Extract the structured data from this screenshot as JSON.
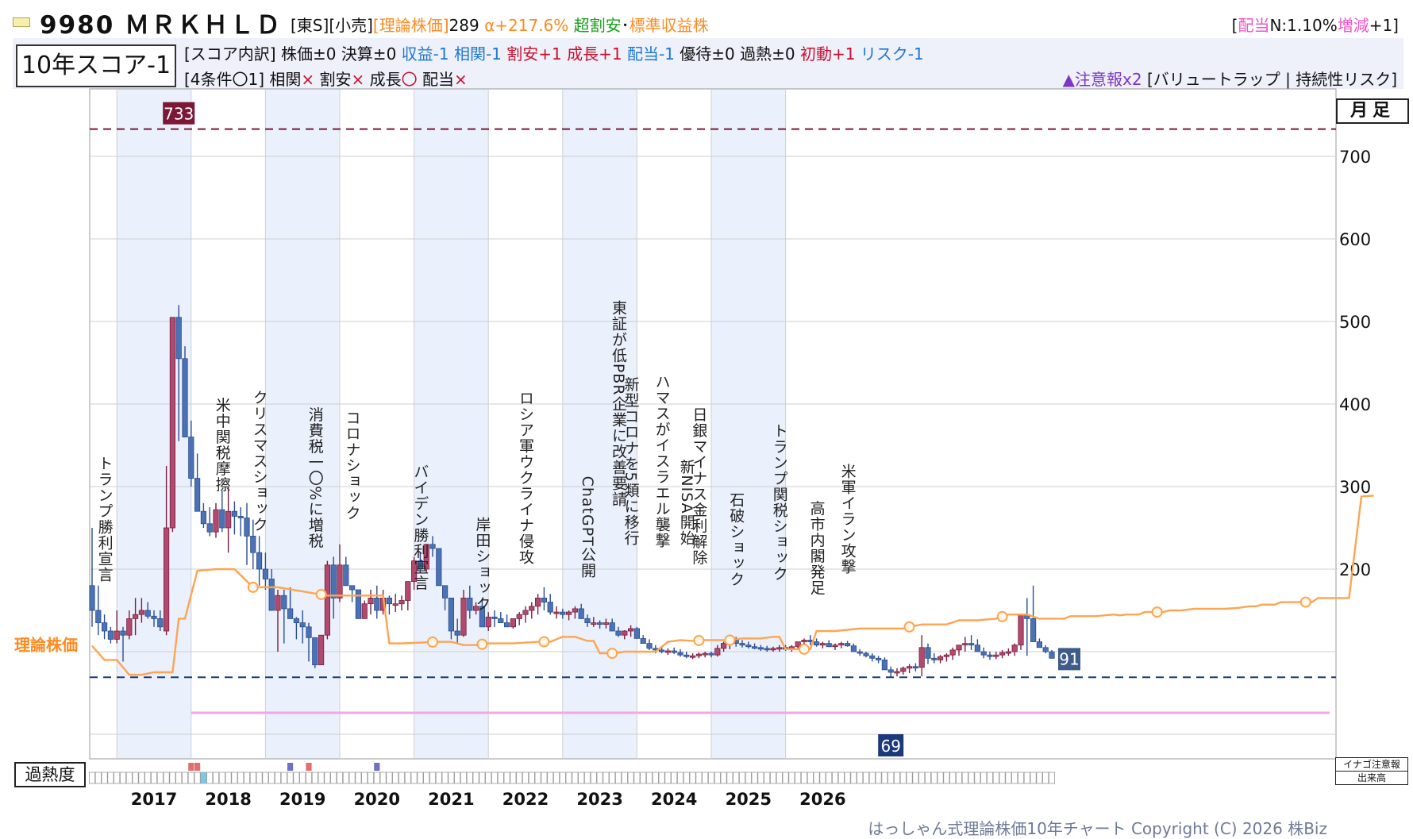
{
  "header": {
    "code_name": "9980 ＭＲＫＨＬＤ",
    "market": "[東S]",
    "sector": "[小売]",
    "theory_label": "[理論株価]",
    "theory_value": "289",
    "alpha": "α+217.6%",
    "valuation": "超割安",
    "dot": "･",
    "category": "標準収益株",
    "dividend_open": "[",
    "dividend_label": "配当",
    "dividend_value": " N:1.10% ",
    "dividend_change_label": "増減",
    "dividend_change_value": "+1]"
  },
  "score": {
    "title": "10年スコア-1",
    "breakdown_label": "[スコア内訳]",
    "items": [
      {
        "text": "株価±0",
        "color": "#111111"
      },
      {
        "text": "決算±0",
        "color": "#111111"
      },
      {
        "text": "収益-1",
        "color": "#1e78d2"
      },
      {
        "text": "相関-1",
        "color": "#1e78d2"
      },
      {
        "text": "割安+1",
        "color": "#c8102e"
      },
      {
        "text": "成長+1",
        "color": "#c8102e"
      },
      {
        "text": "配当-1",
        "color": "#1e78d2"
      },
      {
        "text": "優待±0",
        "color": "#111111"
      },
      {
        "text": "過熱±0",
        "color": "#111111"
      },
      {
        "text": "初動+1",
        "color": "#c8102e"
      },
      {
        "text": "リスク-1",
        "color": "#1e78d2"
      }
    ],
    "conditions_label": "[4条件〇1]",
    "conditions": [
      {
        "name": "相関",
        "mark": "×"
      },
      {
        "name": "割安",
        "mark": "×"
      },
      {
        "name": "成長",
        "mark": "〇"
      },
      {
        "name": "配当",
        "mark": "×"
      }
    ],
    "warning_count": "▲注意報x2",
    "warning_detail": "[バリュートラップ | 持続性リスク]"
  },
  "labels": {
    "period": "月足",
    "theory_line": "理論株価",
    "overheat": "過熱度",
    "inago": "イナゴ注意報",
    "volume": "出来高",
    "copyright": "はっしゃん式理論株価10年チャート Copyright (C) 2026 株Biz"
  },
  "chart_data": {
    "type": "candlestick",
    "title": "",
    "xlabel": "",
    "ylabel": "",
    "ylim": [
      0,
      800
    ],
    "y_ticks": [
      200,
      300,
      400,
      500,
      600,
      700
    ],
    "x_years": [
      "2017",
      "2018",
      "2019",
      "2020",
      "2021",
      "2022",
      "2023",
      "2024",
      "2025",
      "2026"
    ],
    "period_start": "2016-09",
    "highlighted_years": [
      "2017",
      "2019",
      "2021",
      "2023",
      "2025"
    ],
    "reference_lines": {
      "max_value": 733,
      "max_label": "733",
      "min_value": 69,
      "min_label": "69",
      "last_value": 91,
      "last_label": "91",
      "pink_line": 26
    },
    "colors": {
      "up": "#b04a6e",
      "down": "#4c72b6",
      "theory": "#ffa44f",
      "max_line": "#7a1836",
      "min_line": "#1b3a7a",
      "pink": "#f3a7e6",
      "year_band": "#eaf0fc"
    },
    "candles": [
      [
        180,
        250,
        130,
        150
      ],
      [
        150,
        180,
        120,
        135
      ],
      [
        135,
        145,
        115,
        125
      ],
      [
        125,
        130,
        110,
        115
      ],
      [
        115,
        150,
        110,
        125
      ],
      [
        125,
        130,
        88,
        120
      ],
      [
        120,
        150,
        115,
        140
      ],
      [
        140,
        165,
        120,
        145
      ],
      [
        145,
        165,
        135,
        150
      ],
      [
        150,
        160,
        140,
        143
      ],
      [
        143,
        150,
        130,
        140
      ],
      [
        140,
        150,
        125,
        130
      ],
      [
        125,
        325,
        120,
        250
      ],
      [
        250,
        505,
        245,
        505
      ],
      [
        505,
        520,
        355,
        455
      ],
      [
        455,
        470,
        400,
        360
      ],
      [
        360,
        380,
        300,
        310
      ],
      [
        310,
        340,
        280,
        270
      ],
      [
        270,
        280,
        250,
        255
      ],
      [
        255,
        275,
        240,
        245
      ],
      [
        245,
        280,
        238,
        272
      ],
      [
        272,
        295,
        245,
        250
      ],
      [
        250,
        300,
        220,
        270
      ],
      [
        270,
        282,
        242,
        264
      ],
      [
        264,
        275,
        240,
        262
      ],
      [
        262,
        280,
        205,
        240
      ],
      [
        240,
        260,
        200,
        220
      ],
      [
        220,
        240,
        180,
        200
      ],
      [
        200,
        220,
        175,
        188
      ],
      [
        188,
        200,
        150,
        150
      ],
      [
        150,
        175,
        100,
        168
      ],
      [
        168,
        175,
        110,
        152
      ],
      [
        152,
        178,
        140,
        140
      ],
      [
        140,
        142,
        115,
        135
      ],
      [
        135,
        150,
        110,
        130
      ],
      [
        130,
        135,
        88,
        117
      ],
      [
        117,
        115,
        80,
        84
      ],
      [
        84,
        120,
        85,
        120
      ],
      [
        120,
        210,
        115,
        205
      ],
      [
        205,
        215,
        140,
        165
      ],
      [
        165,
        230,
        160,
        205
      ],
      [
        205,
        215,
        190,
        180
      ],
      [
        180,
        178,
        160,
        175
      ],
      [
        175,
        175,
        140,
        140
      ],
      [
        140,
        162,
        140,
        158
      ],
      [
        158,
        175,
        145,
        165
      ],
      [
        165,
        180,
        140,
        150
      ],
      [
        150,
        175,
        145,
        165
      ],
      [
        165,
        168,
        145,
        158
      ],
      [
        158,
        170,
        148,
        158
      ],
      [
        158,
        168,
        150,
        162
      ],
      [
        162,
        180,
        150,
        185
      ],
      [
        185,
        215,
        175,
        210
      ],
      [
        210,
        220,
        195,
        200
      ],
      [
        200,
        230,
        195,
        230
      ],
      [
        230,
        240,
        215,
        225
      ],
      [
        225,
        195,
        180,
        180
      ],
      [
        180,
        165,
        150,
        165
      ],
      [
        165,
        140,
        115,
        125
      ],
      [
        125,
        140,
        110,
        120
      ],
      [
        120,
        175,
        118,
        165
      ],
      [
        165,
        180,
        140,
        150
      ],
      [
        150,
        160,
        145,
        155
      ],
      [
        155,
        163,
        140,
        130
      ],
      [
        130,
        148,
        125,
        142
      ],
      [
        142,
        150,
        130,
        140
      ],
      [
        140,
        148,
        135,
        135
      ],
      [
        135,
        145,
        130,
        130
      ],
      [
        130,
        140,
        128,
        140
      ],
      [
        140,
        148,
        132,
        145
      ],
      [
        145,
        155,
        135,
        150
      ],
      [
        150,
        160,
        140,
        155
      ],
      [
        155,
        170,
        145,
        165
      ],
      [
        165,
        178,
        150,
        160
      ],
      [
        160,
        170,
        145,
        148
      ],
      [
        148,
        155,
        140,
        148
      ],
      [
        148,
        152,
        140,
        145
      ],
      [
        145,
        150,
        138,
        148
      ],
      [
        148,
        155,
        140,
        152
      ],
      [
        152,
        158,
        142,
        140
      ],
      [
        140,
        145,
        130,
        135
      ],
      [
        135,
        142,
        130,
        135
      ],
      [
        135,
        138,
        128,
        134
      ],
      [
        134,
        140,
        128,
        135
      ],
      [
        135,
        140,
        125,
        125
      ],
      [
        125,
        130,
        118,
        120
      ],
      [
        120,
        126,
        115,
        125
      ],
      [
        125,
        132,
        118,
        128
      ],
      [
        128,
        130,
        118,
        116
      ],
      [
        116,
        120,
        110,
        110
      ],
      [
        110,
        115,
        102,
        104
      ],
      [
        104,
        108,
        98,
        102
      ],
      [
        102,
        106,
        98,
        100
      ],
      [
        100,
        104,
        96,
        101
      ],
      [
        101,
        105,
        97,
        99
      ],
      [
        99,
        103,
        94,
        96
      ],
      [
        96,
        100,
        92,
        94
      ],
      [
        94,
        98,
        91,
        95
      ],
      [
        95,
        99,
        92,
        97
      ],
      [
        97,
        100,
        93,
        98
      ],
      [
        98,
        100,
        93,
        96
      ],
      [
        96,
        108,
        94,
        104
      ],
      [
        104,
        112,
        100,
        110
      ],
      [
        110,
        118,
        103,
        114
      ],
      [
        114,
        118,
        106,
        110
      ],
      [
        110,
        114,
        105,
        108
      ],
      [
        108,
        112,
        104,
        106
      ],
      [
        106,
        110,
        103,
        105
      ],
      [
        105,
        108,
        101,
        104
      ],
      [
        104,
        107,
        100,
        103
      ],
      [
        103,
        106,
        100,
        104
      ],
      [
        104,
        108,
        100,
        105
      ],
      [
        105,
        108,
        101,
        103
      ],
      [
        103,
        108,
        100,
        106
      ],
      [
        106,
        110,
        102,
        112
      ],
      [
        112,
        116,
        106,
        114
      ],
      [
        114,
        120,
        108,
        112
      ],
      [
        112,
        116,
        106,
        108
      ],
      [
        108,
        112,
        104,
        110
      ],
      [
        110,
        114,
        106,
        106
      ],
      [
        106,
        110,
        102,
        108
      ],
      [
        108,
        112,
        104,
        110
      ],
      [
        110,
        113,
        106,
        107
      ],
      [
        107,
        110,
        100,
        100
      ],
      [
        100,
        103,
        95,
        98
      ],
      [
        98,
        100,
        93,
        95
      ],
      [
        95,
        98,
        88,
        92
      ],
      [
        92,
        95,
        86,
        90
      ],
      [
        90,
        93,
        80,
        78
      ],
      [
        78,
        82,
        69,
        75
      ],
      [
        75,
        80,
        70,
        76
      ],
      [
        76,
        82,
        72,
        80
      ],
      [
        80,
        85,
        74,
        82
      ],
      [
        82,
        86,
        76,
        81
      ],
      [
        81,
        120,
        70,
        105
      ],
      [
        105,
        110,
        85,
        92
      ],
      [
        92,
        98,
        86,
        90
      ],
      [
        90,
        96,
        86,
        94
      ],
      [
        94,
        98,
        88,
        96
      ],
      [
        96,
        105,
        90,
        102
      ],
      [
        102,
        108,
        95,
        108
      ],
      [
        108,
        118,
        100,
        110
      ],
      [
        110,
        120,
        102,
        108
      ],
      [
        108,
        115,
        100,
        100
      ],
      [
        100,
        105,
        92,
        96
      ],
      [
        96,
        100,
        90,
        95
      ],
      [
        95,
        100,
        91,
        96
      ],
      [
        96,
        102,
        92,
        99
      ],
      [
        99,
        104,
        95,
        100
      ],
      [
        100,
        110,
        95,
        108
      ],
      [
        108,
        120,
        102,
        145
      ],
      [
        145,
        165,
        95,
        140
      ],
      [
        140,
        180,
        125,
        112
      ],
      [
        112,
        116,
        105,
        105
      ],
      [
        105,
        108,
        98,
        100
      ],
      [
        100,
        102,
        92,
        92
      ]
    ],
    "theory_line": [
      [
        0,
        107
      ],
      [
        2,
        90
      ],
      [
        4,
        90
      ],
      [
        6,
        72
      ],
      [
        8,
        72
      ],
      [
        10,
        75
      ],
      [
        12,
        75
      ],
      [
        13,
        75
      ],
      [
        14,
        140
      ],
      [
        15,
        140
      ],
      [
        17,
        198
      ],
      [
        20,
        200
      ],
      [
        22,
        200
      ],
      [
        23,
        200
      ],
      [
        26,
        178
      ],
      [
        30,
        178
      ],
      [
        38,
        168
      ],
      [
        41,
        168
      ],
      [
        47,
        168
      ],
      [
        48,
        110
      ],
      [
        50,
        110
      ],
      [
        56,
        112
      ],
      [
        58,
        112
      ],
      [
        60,
        108
      ],
      [
        62,
        108
      ],
      [
        64,
        110
      ],
      [
        68,
        110
      ],
      [
        72,
        112
      ],
      [
        74,
        112
      ],
      [
        76,
        118
      ],
      [
        78,
        118
      ],
      [
        80,
        113
      ],
      [
        81,
        113
      ],
      [
        82,
        98
      ],
      [
        84,
        98
      ],
      [
        86,
        100
      ],
      [
        88,
        100
      ],
      [
        91,
        100
      ],
      [
        93,
        112
      ],
      [
        95,
        114
      ],
      [
        97,
        113
      ],
      [
        99,
        114
      ],
      [
        101,
        114
      ],
      [
        103,
        114
      ],
      [
        105,
        116
      ],
      [
        108,
        116
      ],
      [
        110,
        118
      ],
      [
        111,
        118
      ],
      [
        112,
        103
      ],
      [
        114,
        103
      ],
      [
        116,
        103
      ],
      [
        117,
        125
      ],
      [
        120,
        125
      ],
      [
        124,
        128
      ],
      [
        128,
        128
      ],
      [
        131,
        128
      ],
      [
        132,
        130
      ],
      [
        134,
        133
      ],
      [
        137,
        133
      ],
      [
        138,
        133
      ],
      [
        140,
        138
      ],
      [
        143,
        138
      ],
      [
        146,
        140
      ],
      [
        148,
        145
      ],
      [
        151,
        145
      ],
      [
        153,
        140
      ],
      [
        155,
        140
      ],
      [
        157,
        140
      ],
      [
        158,
        143
      ],
      [
        160,
        143
      ],
      [
        162,
        143
      ],
      [
        165,
        145
      ],
      [
        166,
        144
      ],
      [
        167,
        145
      ],
      [
        169,
        145
      ],
      [
        170,
        148
      ],
      [
        173,
        148
      ],
      [
        174,
        150
      ],
      [
        176,
        150
      ],
      [
        178,
        152
      ],
      [
        180,
        152
      ],
      [
        183,
        152
      ],
      [
        185,
        153
      ],
      [
        187,
        155
      ],
      [
        188,
        155
      ],
      [
        189,
        157
      ],
      [
        191,
        157
      ],
      [
        192,
        160
      ],
      [
        195,
        160
      ],
      [
        197,
        160
      ],
      [
        198,
        165
      ],
      [
        200,
        165
      ],
      [
        203,
        165
      ],
      [
        205,
        288
      ],
      [
        207,
        289
      ]
    ],
    "theory_markers": [
      26,
      37,
      55,
      63,
      73,
      84,
      98,
      103,
      115,
      132,
      147,
      172,
      196
    ],
    "events": [
      {
        "label": "トランプ勝利宣言",
        "month": 2,
        "value": 280
      },
      {
        "label": "米中関税摩擦",
        "month": 21,
        "value": 370
      },
      {
        "label": "クリスマスショック",
        "month": 27,
        "value": 350
      },
      {
        "label": "消費税一〇%に増税",
        "month": 36,
        "value": 330
      },
      {
        "label": "コロナショック",
        "month": 42,
        "value": 345
      },
      {
        "label": "バイデン勝利宣言",
        "month": 53,
        "value": 270
      },
      {
        "label": "岸田ショック",
        "month": 63,
        "value": 225
      },
      {
        "label": "ロシア軍ウクライナ侵攻",
        "month": 70,
        "value": 330
      },
      {
        "label": "ChatGPT公開",
        "month": 80,
        "value": 270
      },
      {
        "label": "東証が低PBR企業に改善要請",
        "month": 85,
        "value": 420
      },
      {
        "label": "新型コロナを5類に移行",
        "month": 87,
        "value": 350
      },
      {
        "label": "ハマスがイスラエル襲撃",
        "month": 92,
        "value": 350
      },
      {
        "label": "新NISA開始",
        "month": 96,
        "value": 300
      },
      {
        "label": "日銀マイナス金利解除",
        "month": 98,
        "value": 320
      },
      {
        "label": "石破ショック",
        "month": 104,
        "value": 255
      },
      {
        "label": "トランプ関税ショック",
        "month": 111,
        "value": 300
      },
      {
        "label": "高市内閣発足",
        "month": 117,
        "value": 245
      },
      {
        "label": "米軍イラン攻撃",
        "month": 122,
        "value": 280
      }
    ],
    "overheat_markers": [
      {
        "month": 16,
        "color": "#e07070"
      },
      {
        "month": 17,
        "color": "#e07070"
      },
      {
        "month": 18,
        "color": "#7fc6e0"
      },
      {
        "month": 32,
        "color": "#7070c0"
      },
      {
        "month": 35,
        "color": "#e07070"
      },
      {
        "month": 46,
        "color": "#7070c0"
      }
    ]
  }
}
